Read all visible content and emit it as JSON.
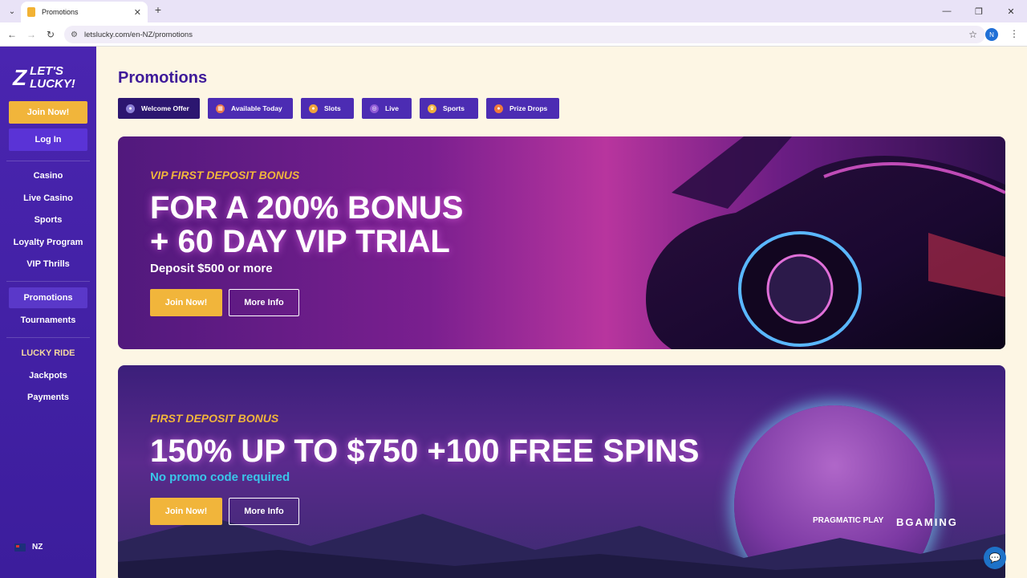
{
  "browser": {
    "tab_title": "Promotions",
    "url": "letslucky.com/en-NZ/promotions",
    "profile_initial": "N",
    "icons": {
      "menu": "chevron-down-icon",
      "close": "close-icon",
      "new_tab": "plus-icon",
      "back": "arrow-left-icon",
      "forward": "arrow-right-icon",
      "reload": "reload-icon",
      "site_info": "site-info-icon",
      "bookmark": "star-icon",
      "more": "kebab-icon"
    }
  },
  "sidebar": {
    "logo_text": "LET'S LUCKY!",
    "join_label": "Join Now!",
    "login_label": "Log In",
    "nav": [
      {
        "label": "Casino"
      },
      {
        "label": "Live Casino"
      },
      {
        "label": "Sports"
      },
      {
        "label": "Loyalty Program"
      },
      {
        "label": "VIP Thrills"
      }
    ],
    "nav2": [
      {
        "label": "Promotions",
        "active": true
      },
      {
        "label": "Tournaments"
      }
    ],
    "nav3": [
      {
        "label": "LUCKY RIDE"
      },
      {
        "label": "Jackpots"
      },
      {
        "label": "Payments"
      }
    ],
    "locale": "NZ"
  },
  "main": {
    "title": "Promotions",
    "filters": [
      {
        "label": "Welcome Offer",
        "icon": "welcome-offer-icon",
        "active": true
      },
      {
        "label": "Available Today",
        "icon": "calendar-icon"
      },
      {
        "label": "Slots",
        "icon": "slots-icon"
      },
      {
        "label": "Live",
        "icon": "live-icon"
      },
      {
        "label": "Sports",
        "icon": "trophy-icon"
      },
      {
        "label": "Prize Drops",
        "icon": "prize-drops-icon"
      }
    ],
    "banners": [
      {
        "eyebrow": "VIP FIRST DEPOSIT BONUS",
        "headline_line1": "FOR A 200% BONUS",
        "headline_line2": "+ 60 DAY VIP TRIAL",
        "sub": "Deposit $500 or more",
        "join_label": "Join Now!",
        "more_label": "More Info"
      },
      {
        "eyebrow": "FIRST DEPOSIT BONUS",
        "headline": "150% UP TO $750 +100 FREE SPINS",
        "sub": "No promo code required",
        "join_label": "Join Now!",
        "more_label": "More Info",
        "partners": [
          "PRAGMATIC PLAY",
          "BGAMING"
        ]
      }
    ]
  },
  "colors": {
    "sidebar": "#4a25b0",
    "accent": "#f1b53b",
    "title": "#3e1a99",
    "background": "#fdf6e4",
    "cyan": "#39c6ea"
  }
}
